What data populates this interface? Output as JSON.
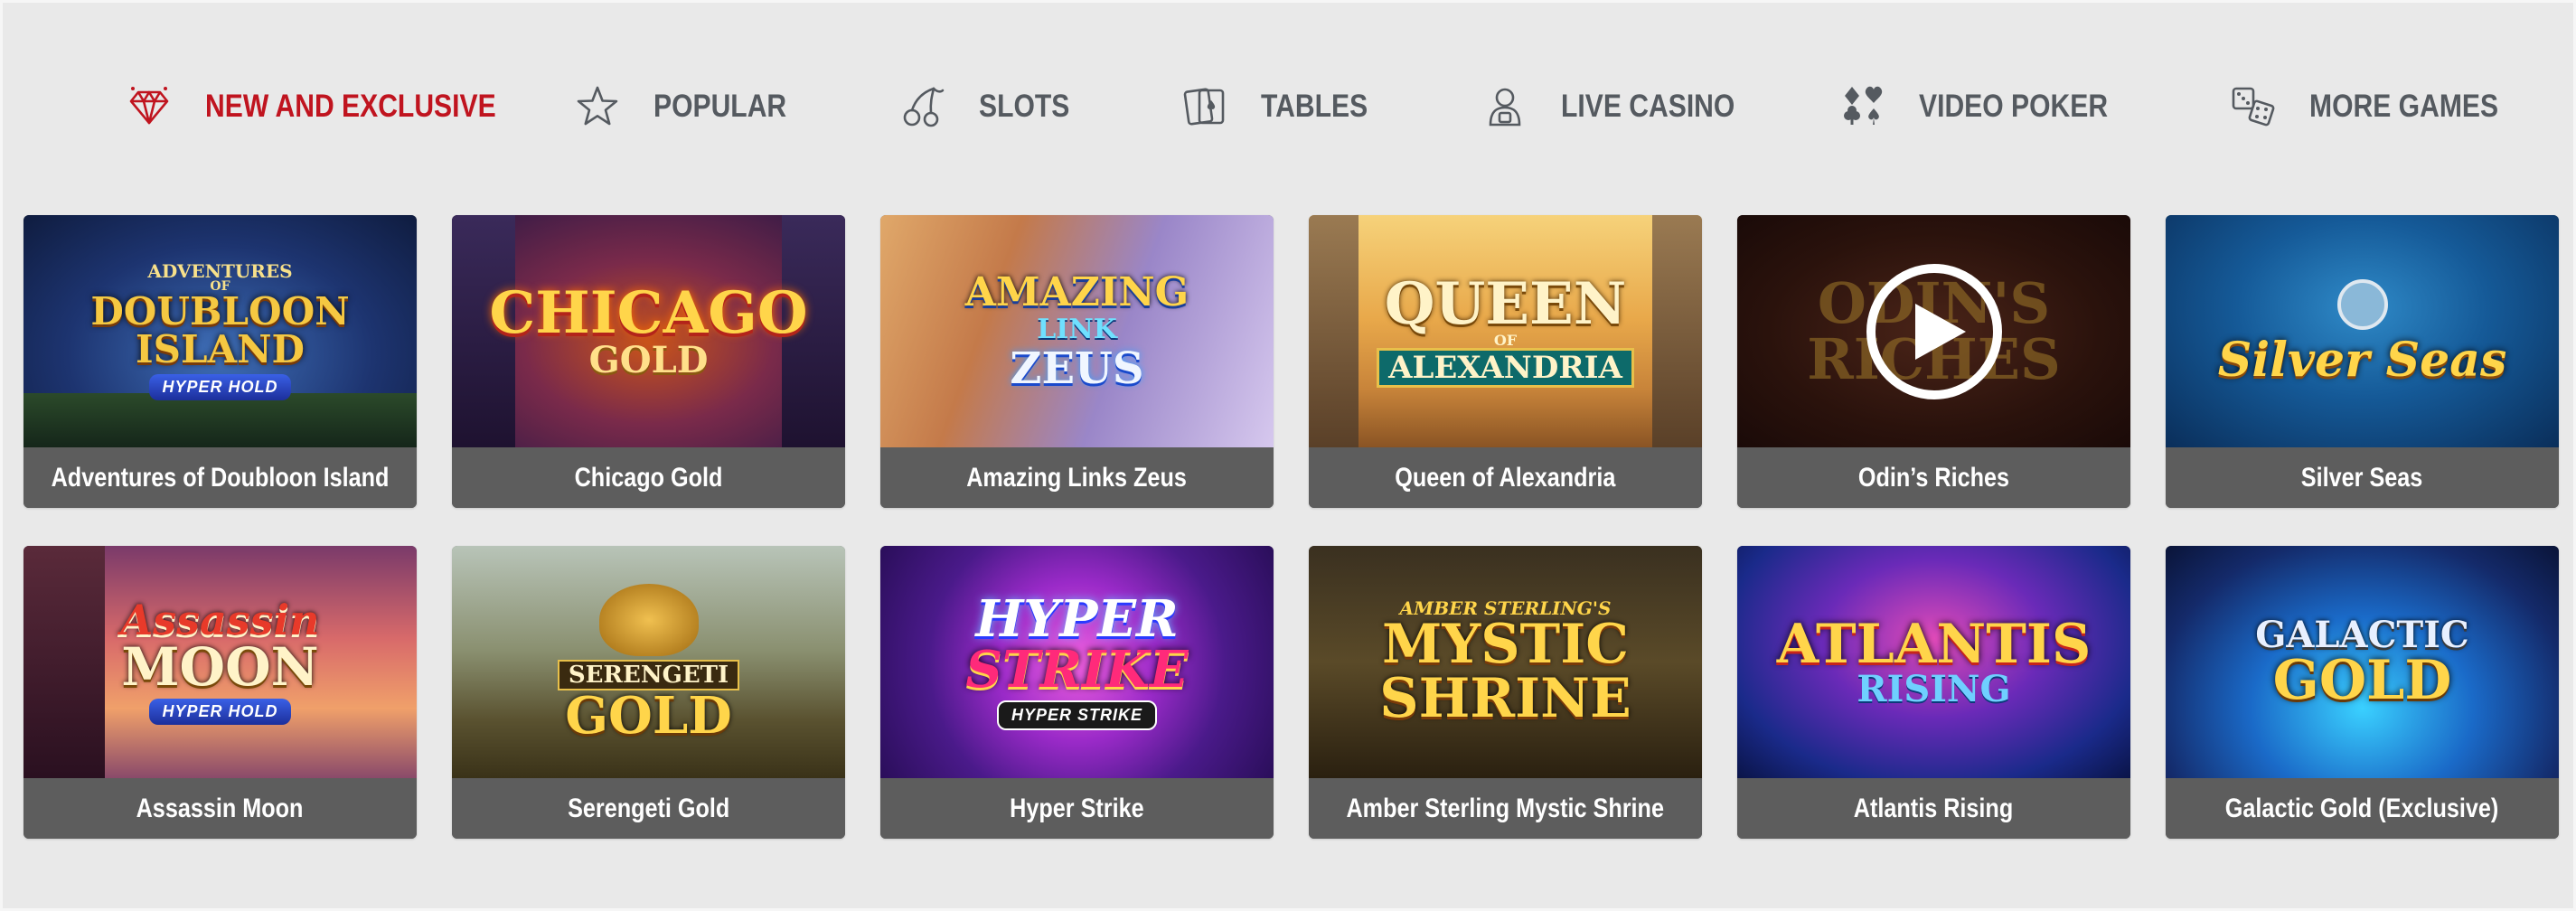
{
  "nav": {
    "items": [
      {
        "label": "NEW AND EXCLUSIVE",
        "icon": "diamond-icon",
        "active": true
      },
      {
        "label": "POPULAR",
        "icon": "star-icon",
        "active": false
      },
      {
        "label": "SLOTS",
        "icon": "cherries-icon",
        "active": false
      },
      {
        "label": "TABLES",
        "icon": "playing-cards-icon",
        "active": false
      },
      {
        "label": "LIVE CASINO",
        "icon": "live-dealer-icon",
        "active": false
      },
      {
        "label": "VIDEO POKER",
        "icon": "card-suits-icon",
        "active": false
      },
      {
        "label": "MORE GAMES",
        "icon": "dice-icon",
        "active": false
      }
    ],
    "active_color": "#c0141f",
    "inactive_color": "#555a60"
  },
  "games": [
    {
      "title": "Adventures of Doubloon Island",
      "logo": [
        "ADVENTURES",
        "OF",
        "DOUBLOON",
        "ISLAND"
      ],
      "badge": "HYPER HOLD"
    },
    {
      "title": "Chicago Gold",
      "logo": [
        "CHICAGO",
        "GOLD"
      ],
      "badge": ""
    },
    {
      "title": "Amazing Links Zeus",
      "logo": [
        "AMAZING",
        "LINK",
        "ZEUS"
      ],
      "badge": ""
    },
    {
      "title": "Queen of Alexandria",
      "logo": [
        "QUEEN",
        "OF",
        "ALEXANDRIA"
      ],
      "badge": ""
    },
    {
      "title": "Odin’s Riches",
      "logo": [
        "ODIN'S",
        "RICHES"
      ],
      "badge": "",
      "play_icon": "play-icon"
    },
    {
      "title": "Silver Seas",
      "logo": [
        "Silver Seas"
      ],
      "badge": ""
    },
    {
      "title": "Assassin Moon",
      "logo": [
        "Assassin",
        "MOON"
      ],
      "badge": "HYPER HOLD"
    },
    {
      "title": "Serengeti Gold",
      "logo": [
        "SERENGETI",
        "GOLD"
      ],
      "badge": ""
    },
    {
      "title": "Hyper Strike",
      "logo": [
        "HYPER",
        "STRIKE"
      ],
      "badge": "HYPER STRIKE"
    },
    {
      "title": "Amber Sterling Mystic Shrine",
      "logo": [
        "AMBER STERLING'S",
        "MYSTIC",
        "SHRINE"
      ],
      "badge": ""
    },
    {
      "title": "Atlantis Rising",
      "logo": [
        "ATLANTIS",
        "RISING"
      ],
      "badge": ""
    },
    {
      "title": "Galactic Gold (Exclusive)",
      "logo": [
        "GALACTIC",
        "GOLD"
      ],
      "badge": ""
    }
  ]
}
